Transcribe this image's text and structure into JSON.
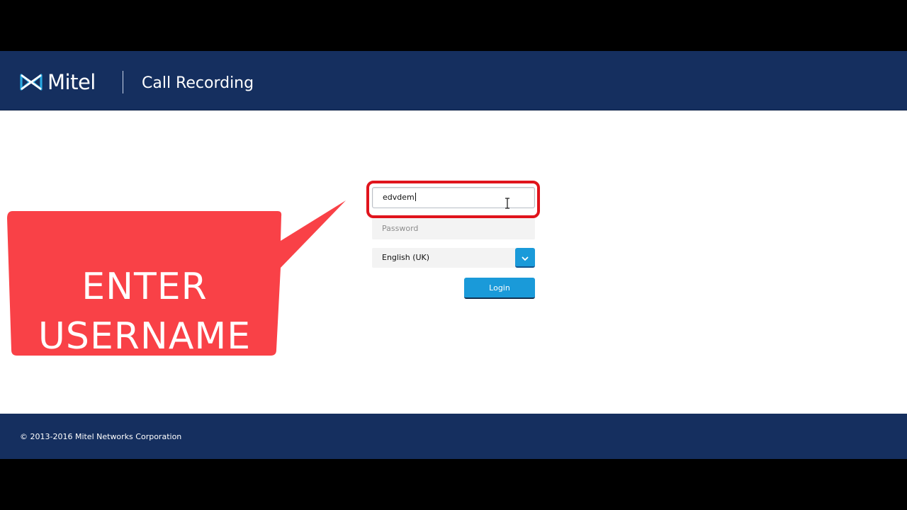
{
  "header": {
    "logo_text": "Mitel",
    "logo_icon": "mitel-bowtie-icon",
    "app_title": "Call Recording"
  },
  "login_form": {
    "username_value": "edvdem",
    "password_placeholder": "Password",
    "language_selected": "English (UK)",
    "login_label": "Login"
  },
  "callout": {
    "line1": "ENTER",
    "line2": "USERNAME",
    "color": "#f94147"
  },
  "footer": {
    "copyright": "© 2013-2016 Mitel Networks Corporation"
  },
  "colors": {
    "header_bg": "#152f5f",
    "accent_blue": "#1a9ad9",
    "highlight_red": "#e0141c"
  }
}
